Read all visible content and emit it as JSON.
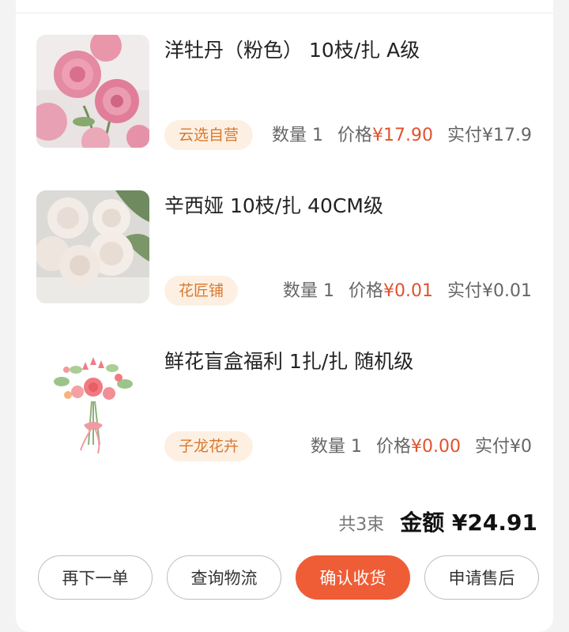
{
  "items": [
    {
      "title": "洋牡丹（粉色） 10枝/扎  A级",
      "shop": "云选自营",
      "qty_label": "数量 1",
      "price_label": "价格",
      "price_value": "¥17.90",
      "paid_label": "实付¥17.9",
      "image": "pink-ranunculus-photo"
    },
    {
      "title": "辛西娅 10枝/扎  40CM级",
      "shop": "花匠铺",
      "qty_label": "数量 1",
      "price_label": "价格",
      "price_value": "¥0.01",
      "paid_label": "实付¥0.01",
      "image": "white-roses-photo"
    },
    {
      "title": "鲜花盲盒福利 1扎/扎  随机级",
      "shop": "子龙花卉",
      "qty_label": "数量 1",
      "price_label": "价格",
      "price_value": "¥0.00",
      "paid_label": "实付¥0",
      "image": "watercolor-bouquet-illustration"
    }
  ],
  "summary": {
    "count_label": "共3束",
    "total_label": "金额 ¥24.91"
  },
  "actions": {
    "reorder": "再下一单",
    "track": "查询物流",
    "confirm": "确认收货",
    "aftersale": "申请售后"
  },
  "colors": {
    "accent": "#ef5d36",
    "price_red": "#e0522e",
    "tag_bg": "#fdf0e2",
    "tag_text": "#d9782f"
  }
}
